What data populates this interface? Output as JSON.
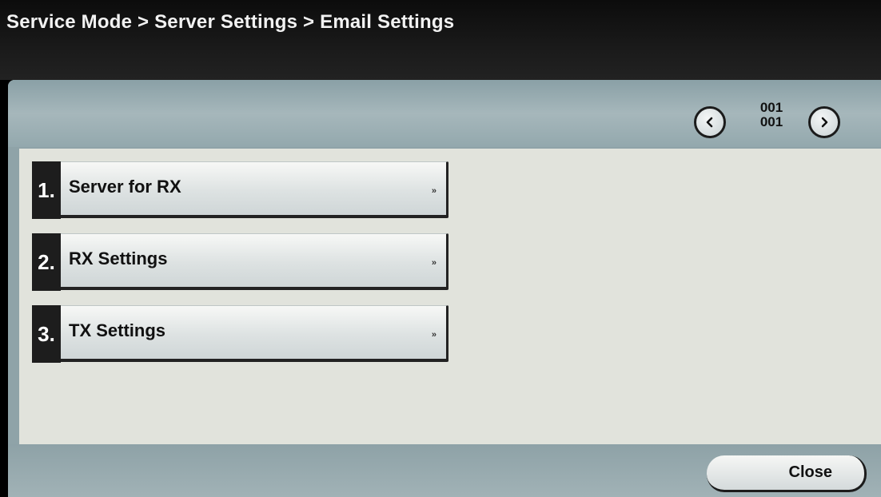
{
  "header": {
    "breadcrumb": "Service Mode > Server Settings > Email Settings"
  },
  "pager": {
    "current": "001",
    "total": "001",
    "prev_icon": "chevron-left-icon",
    "next_icon": "chevron-right-icon"
  },
  "menu": {
    "items": [
      {
        "number": "1.",
        "label": "Server for RX",
        "arrow": "»"
      },
      {
        "number": "2.",
        "label": "RX Settings",
        "arrow": "»"
      },
      {
        "number": "3.",
        "label": "TX Settings",
        "arrow": "»"
      }
    ]
  },
  "footer": {
    "close_label": "Close"
  }
}
